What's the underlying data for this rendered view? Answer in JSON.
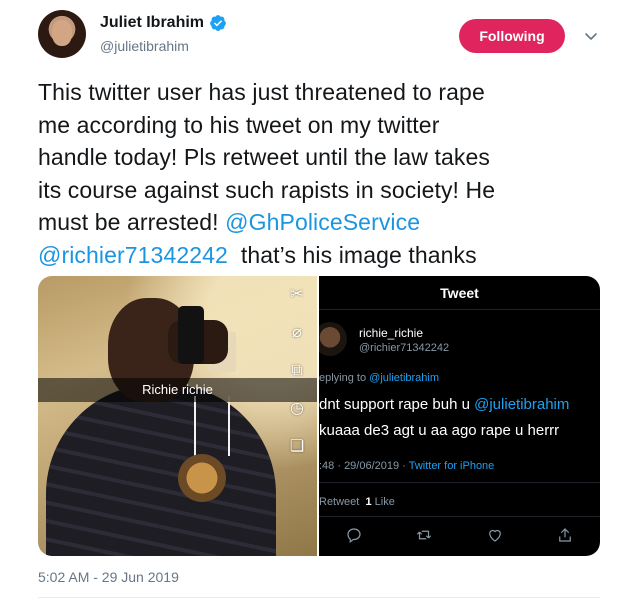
{
  "author": {
    "display_name": "Juliet Ibrahim",
    "handle": "@julietibrahim",
    "verified": true
  },
  "follow_button": {
    "label": "Following",
    "color": "#e0245e"
  },
  "tweet": {
    "text_lines": [
      "This twitter user has just threatened to rape",
      "me according to his tweet on my twitter",
      "handle today! Pls retweet until the law takes",
      "its course against such rapists in society! He"
    ],
    "line5_prefix": "must be arrested! ",
    "mention1": "@GhPoliceService",
    "mention2": "@richier71342242",
    "line6_suffix": "  that’s his image thanks",
    "timestamp": "5:02 AM - 29 Jun 2019"
  },
  "media": {
    "photo_caption": "Richie richie",
    "screenshot": {
      "header": "Tweet",
      "name": "richie_richie",
      "handle": "@richier71342242",
      "reply_prefix": "eplying to ",
      "reply_mention": "@julietibrahim",
      "line1_prefix": "dnt support rape buh u ",
      "line1_mention": "@julietibrahim",
      "line2": "kuaaa de3 agt u aa ago rape u herrr",
      "meta_time": ":48 · 29/06/2019 · ",
      "meta_source": "Twitter for iPhone",
      "stats_prefix": "Retweet  ",
      "stats_count": "1",
      "stats_suffix": " Like"
    }
  },
  "colors": {
    "link": "#1b95e0",
    "secondary_text": "#657786"
  }
}
